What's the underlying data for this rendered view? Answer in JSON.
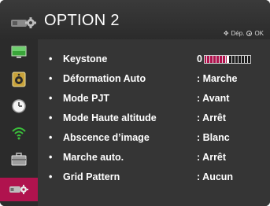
{
  "header": {
    "title": "OPTION 2",
    "nav_hint_move": "Dép.",
    "nav_hint_ok": "OK"
  },
  "sidebar": {
    "items": [
      {
        "icon": "picture-icon",
        "active": false
      },
      {
        "icon": "speaker-icon",
        "active": false
      },
      {
        "icon": "clock-icon",
        "active": false
      },
      {
        "icon": "wifi-icon",
        "active": false
      },
      {
        "icon": "toolbox-icon",
        "active": false
      },
      {
        "icon": "projector-settings-icon",
        "active": true
      }
    ]
  },
  "settings": [
    {
      "bullet": "•",
      "label": "Keystone",
      "value": "0"
    },
    {
      "bullet": "•",
      "label": "Déformation Auto",
      "value": ": Marche"
    },
    {
      "bullet": "•",
      "label": "Mode PJT",
      "value": ": Avant"
    },
    {
      "bullet": "•",
      "label": "Mode Haute altitude",
      "value": ": Arrêt"
    },
    {
      "bullet": "•",
      "label": "Abscence d’image",
      "value": ": Blanc"
    },
    {
      "bullet": "•",
      "label": "Marche auto.",
      "value": ": Arrêt"
    },
    {
      "bullet": "•",
      "label": "Grid Pattern",
      "value": ": Aucun"
    }
  ],
  "keystone_slider": {
    "level_fraction": 0.5
  },
  "colors": {
    "accent": "#b0134e",
    "background": "#2a2a2a",
    "text": "#ffffff"
  }
}
